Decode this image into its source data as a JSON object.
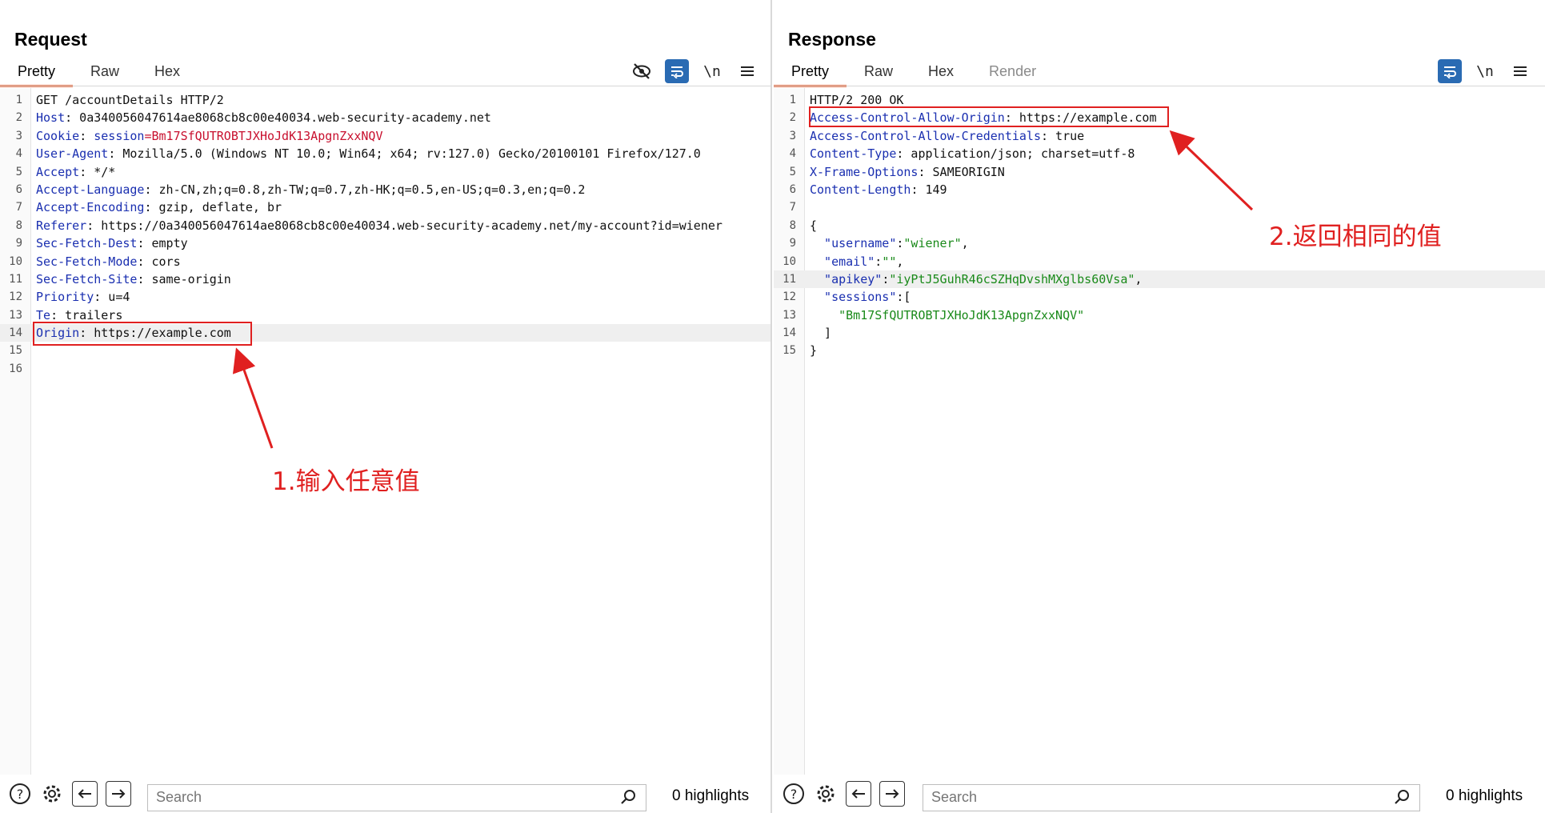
{
  "request": {
    "title": "Request",
    "tabs": [
      "Pretty",
      "Raw",
      "Hex"
    ],
    "tools": {
      "hide_icon": "eye-off-icon",
      "wrap_icon": "wrap-icon",
      "newline_label": "\\n",
      "menu_icon": "menu-icon"
    },
    "lines": [
      {
        "n": "1",
        "parts": [
          {
            "t": "GET /accountDetails HTTP/2",
            "c": "v"
          }
        ]
      },
      {
        "n": "2",
        "parts": [
          {
            "t": "Host",
            "c": "k"
          },
          {
            "t": ": 0a340056047614ae8068cb8c00e40034.web-security-academy.net",
            "c": "v"
          }
        ]
      },
      {
        "n": "3",
        "parts": [
          {
            "t": "Cookie",
            "c": "k"
          },
          {
            "t": ": ",
            "c": "v"
          },
          {
            "t": "session",
            "c": "k"
          },
          {
            "t": "=Bm17SfQUTROBTJXHoJdK13ApgnZxxNQV",
            "c": "cv"
          }
        ]
      },
      {
        "n": "4",
        "parts": [
          {
            "t": "User-Agent",
            "c": "k"
          },
          {
            "t": ": Mozilla/5.0 (Windows NT 10.0; Win64; x64; rv:127.0) Gecko/20100101 Firefox/127.0",
            "c": "v"
          }
        ]
      },
      {
        "n": "5",
        "parts": [
          {
            "t": "Accept",
            "c": "k"
          },
          {
            "t": ": */*",
            "c": "v"
          }
        ]
      },
      {
        "n": "6",
        "parts": [
          {
            "t": "Accept-Language",
            "c": "k"
          },
          {
            "t": ": zh-CN,zh;q=0.8,zh-TW;q=0.7,zh-HK;q=0.5,en-US;q=0.3,en;q=0.2",
            "c": "v"
          }
        ]
      },
      {
        "n": "7",
        "parts": [
          {
            "t": "Accept-Encoding",
            "c": "k"
          },
          {
            "t": ": gzip, deflate, br",
            "c": "v"
          }
        ]
      },
      {
        "n": "8",
        "parts": [
          {
            "t": "Referer",
            "c": "k"
          },
          {
            "t": ": https://0a340056047614ae8068cb8c00e40034.web-security-academy.net/my-account?id=wiener",
            "c": "v"
          }
        ]
      },
      {
        "n": "9",
        "parts": [
          {
            "t": "Sec-Fetch-Dest",
            "c": "k"
          },
          {
            "t": ": empty",
            "c": "v"
          }
        ]
      },
      {
        "n": "10",
        "parts": [
          {
            "t": "Sec-Fetch-Mode",
            "c": "k"
          },
          {
            "t": ": cors",
            "c": "v"
          }
        ]
      },
      {
        "n": "11",
        "parts": [
          {
            "t": "Sec-Fetch-Site",
            "c": "k"
          },
          {
            "t": ": same-origin",
            "c": "v"
          }
        ]
      },
      {
        "n": "12",
        "parts": [
          {
            "t": "Priority",
            "c": "k"
          },
          {
            "t": ": u=4",
            "c": "v"
          }
        ]
      },
      {
        "n": "13",
        "parts": [
          {
            "t": "Te",
            "c": "k"
          },
          {
            "t": ": trailers",
            "c": "v"
          }
        ]
      },
      {
        "n": "14",
        "hl": true,
        "parts": [
          {
            "t": "Origin",
            "c": "k"
          },
          {
            "t": ": https://example.com",
            "c": "v"
          }
        ]
      },
      {
        "n": "15",
        "parts": []
      },
      {
        "n": "16",
        "parts": []
      }
    ],
    "search_placeholder": "Search",
    "highlights": "0 highlights"
  },
  "response": {
    "title": "Response",
    "tabs": [
      "Pretty",
      "Raw",
      "Hex",
      "Render"
    ],
    "tools": {
      "wrap_icon": "wrap-icon",
      "newline_label": "\\n",
      "menu_icon": "menu-icon"
    },
    "lines": [
      {
        "n": "1",
        "parts": [
          {
            "t": "HTTP/2 200 OK",
            "c": "v"
          }
        ]
      },
      {
        "n": "2",
        "parts": [
          {
            "t": "Access-Control-Allow-Origin",
            "c": "k"
          },
          {
            "t": ": https://example.com",
            "c": "v"
          }
        ]
      },
      {
        "n": "3",
        "parts": [
          {
            "t": "Access-Control-Allow-Credentials",
            "c": "k"
          },
          {
            "t": ": true",
            "c": "v"
          }
        ]
      },
      {
        "n": "4",
        "parts": [
          {
            "t": "Content-Type",
            "c": "k"
          },
          {
            "t": ": application/json; charset=utf-8",
            "c": "v"
          }
        ]
      },
      {
        "n": "5",
        "parts": [
          {
            "t": "X-Frame-Options",
            "c": "k"
          },
          {
            "t": ": SAMEORIGIN",
            "c": "v"
          }
        ]
      },
      {
        "n": "6",
        "parts": [
          {
            "t": "Content-Length",
            "c": "k"
          },
          {
            "t": ": 149",
            "c": "v"
          }
        ]
      },
      {
        "n": "7",
        "parts": []
      },
      {
        "n": "8",
        "parts": [
          {
            "t": "{",
            "c": "v"
          }
        ]
      },
      {
        "n": "9",
        "parts": [
          {
            "t": "  \"username\"",
            "c": "k"
          },
          {
            "t": ":",
            "c": "v"
          },
          {
            "t": "\"wiener\"",
            "c": "s"
          },
          {
            "t": ",",
            "c": "v"
          }
        ]
      },
      {
        "n": "10",
        "parts": [
          {
            "t": "  \"email\"",
            "c": "k"
          },
          {
            "t": ":",
            "c": "v"
          },
          {
            "t": "\"\"",
            "c": "s"
          },
          {
            "t": ",",
            "c": "v"
          }
        ]
      },
      {
        "n": "11",
        "hl": true,
        "parts": [
          {
            "t": "  \"apikey\"",
            "c": "k"
          },
          {
            "t": ":",
            "c": "v"
          },
          {
            "t": "\"iyPtJ5GuhR46cSZHqDvshMXglbs60Vsa\"",
            "c": "s"
          },
          {
            "t": ",",
            "c": "v"
          }
        ]
      },
      {
        "n": "12",
        "parts": [
          {
            "t": "  \"sessions\"",
            "c": "k"
          },
          {
            "t": ":[",
            "c": "v"
          }
        ]
      },
      {
        "n": "13",
        "parts": [
          {
            "t": "    \"Bm17SfQUTROBTJXHoJdK13ApgnZxxNQV\"",
            "c": "s"
          }
        ]
      },
      {
        "n": "14",
        "parts": [
          {
            "t": "  ]",
            "c": "v"
          }
        ]
      },
      {
        "n": "15",
        "parts": [
          {
            "t": "}",
            "c": "v"
          }
        ]
      }
    ],
    "search_placeholder": "Search",
    "highlights": "0 highlights"
  },
  "annotations": {
    "request_note": "1.输入任意值",
    "response_note": "2.返回相同的值"
  },
  "colors": {
    "accent": "#2a6bb3",
    "annotation": "#e02020",
    "header_key": "#1a2fb0",
    "json_string": "#1a8a1a",
    "cookie_value": "#c8102e"
  }
}
